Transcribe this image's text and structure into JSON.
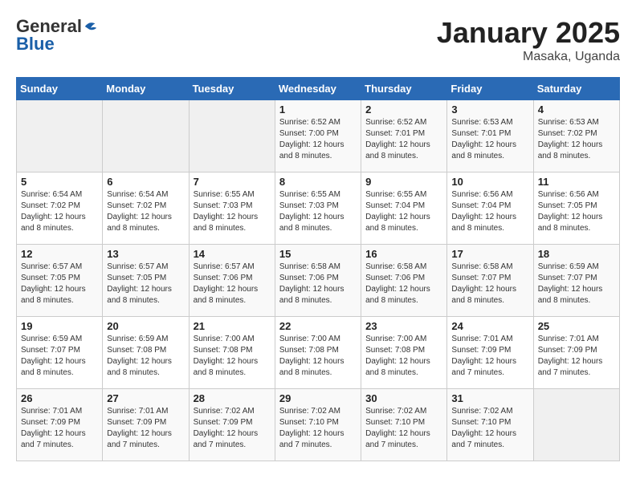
{
  "logo": {
    "general": "General",
    "blue": "Blue"
  },
  "title": "January 2025",
  "location": "Masaka, Uganda",
  "days_of_week": [
    "Sunday",
    "Monday",
    "Tuesday",
    "Wednesday",
    "Thursday",
    "Friday",
    "Saturday"
  ],
  "weeks": [
    [
      {
        "day": "",
        "info": ""
      },
      {
        "day": "",
        "info": ""
      },
      {
        "day": "",
        "info": ""
      },
      {
        "day": "1",
        "info": "Sunrise: 6:52 AM\nSunset: 7:00 PM\nDaylight: 12 hours\nand 8 minutes."
      },
      {
        "day": "2",
        "info": "Sunrise: 6:52 AM\nSunset: 7:01 PM\nDaylight: 12 hours\nand 8 minutes."
      },
      {
        "day": "3",
        "info": "Sunrise: 6:53 AM\nSunset: 7:01 PM\nDaylight: 12 hours\nand 8 minutes."
      },
      {
        "day": "4",
        "info": "Sunrise: 6:53 AM\nSunset: 7:02 PM\nDaylight: 12 hours\nand 8 minutes."
      }
    ],
    [
      {
        "day": "5",
        "info": "Sunrise: 6:54 AM\nSunset: 7:02 PM\nDaylight: 12 hours\nand 8 minutes."
      },
      {
        "day": "6",
        "info": "Sunrise: 6:54 AM\nSunset: 7:02 PM\nDaylight: 12 hours\nand 8 minutes."
      },
      {
        "day": "7",
        "info": "Sunrise: 6:55 AM\nSunset: 7:03 PM\nDaylight: 12 hours\nand 8 minutes."
      },
      {
        "day": "8",
        "info": "Sunrise: 6:55 AM\nSunset: 7:03 PM\nDaylight: 12 hours\nand 8 minutes."
      },
      {
        "day": "9",
        "info": "Sunrise: 6:55 AM\nSunset: 7:04 PM\nDaylight: 12 hours\nand 8 minutes."
      },
      {
        "day": "10",
        "info": "Sunrise: 6:56 AM\nSunset: 7:04 PM\nDaylight: 12 hours\nand 8 minutes."
      },
      {
        "day": "11",
        "info": "Sunrise: 6:56 AM\nSunset: 7:05 PM\nDaylight: 12 hours\nand 8 minutes."
      }
    ],
    [
      {
        "day": "12",
        "info": "Sunrise: 6:57 AM\nSunset: 7:05 PM\nDaylight: 12 hours\nand 8 minutes."
      },
      {
        "day": "13",
        "info": "Sunrise: 6:57 AM\nSunset: 7:05 PM\nDaylight: 12 hours\nand 8 minutes."
      },
      {
        "day": "14",
        "info": "Sunrise: 6:57 AM\nSunset: 7:06 PM\nDaylight: 12 hours\nand 8 minutes."
      },
      {
        "day": "15",
        "info": "Sunrise: 6:58 AM\nSunset: 7:06 PM\nDaylight: 12 hours\nand 8 minutes."
      },
      {
        "day": "16",
        "info": "Sunrise: 6:58 AM\nSunset: 7:06 PM\nDaylight: 12 hours\nand 8 minutes."
      },
      {
        "day": "17",
        "info": "Sunrise: 6:58 AM\nSunset: 7:07 PM\nDaylight: 12 hours\nand 8 minutes."
      },
      {
        "day": "18",
        "info": "Sunrise: 6:59 AM\nSunset: 7:07 PM\nDaylight: 12 hours\nand 8 minutes."
      }
    ],
    [
      {
        "day": "19",
        "info": "Sunrise: 6:59 AM\nSunset: 7:07 PM\nDaylight: 12 hours\nand 8 minutes."
      },
      {
        "day": "20",
        "info": "Sunrise: 6:59 AM\nSunset: 7:08 PM\nDaylight: 12 hours\nand 8 minutes."
      },
      {
        "day": "21",
        "info": "Sunrise: 7:00 AM\nSunset: 7:08 PM\nDaylight: 12 hours\nand 8 minutes."
      },
      {
        "day": "22",
        "info": "Sunrise: 7:00 AM\nSunset: 7:08 PM\nDaylight: 12 hours\nand 8 minutes."
      },
      {
        "day": "23",
        "info": "Sunrise: 7:00 AM\nSunset: 7:08 PM\nDaylight: 12 hours\nand 8 minutes."
      },
      {
        "day": "24",
        "info": "Sunrise: 7:01 AM\nSunset: 7:09 PM\nDaylight: 12 hours\nand 7 minutes."
      },
      {
        "day": "25",
        "info": "Sunrise: 7:01 AM\nSunset: 7:09 PM\nDaylight: 12 hours\nand 7 minutes."
      }
    ],
    [
      {
        "day": "26",
        "info": "Sunrise: 7:01 AM\nSunset: 7:09 PM\nDaylight: 12 hours\nand 7 minutes."
      },
      {
        "day": "27",
        "info": "Sunrise: 7:01 AM\nSunset: 7:09 PM\nDaylight: 12 hours\nand 7 minutes."
      },
      {
        "day": "28",
        "info": "Sunrise: 7:02 AM\nSunset: 7:09 PM\nDaylight: 12 hours\nand 7 minutes."
      },
      {
        "day": "29",
        "info": "Sunrise: 7:02 AM\nSunset: 7:10 PM\nDaylight: 12 hours\nand 7 minutes."
      },
      {
        "day": "30",
        "info": "Sunrise: 7:02 AM\nSunset: 7:10 PM\nDaylight: 12 hours\nand 7 minutes."
      },
      {
        "day": "31",
        "info": "Sunrise: 7:02 AM\nSunset: 7:10 PM\nDaylight: 12 hours\nand 7 minutes."
      },
      {
        "day": "",
        "info": ""
      }
    ]
  ]
}
